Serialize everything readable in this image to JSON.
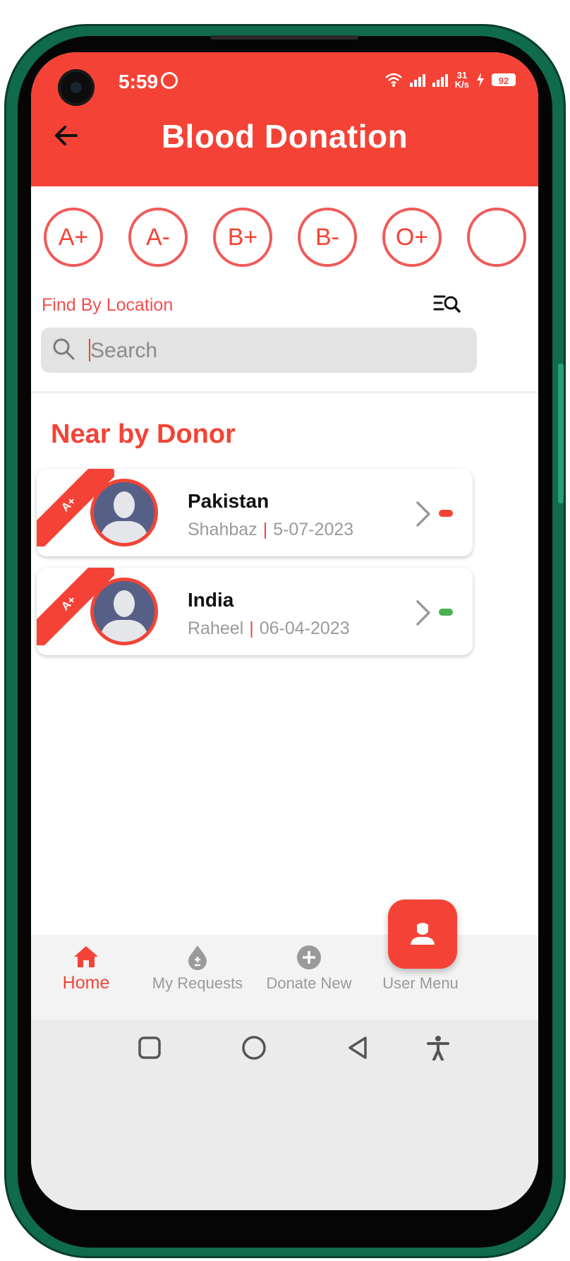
{
  "status_bar": {
    "time": "5:59",
    "net_speed_value": "31",
    "net_speed_unit": "K/s",
    "battery": "92"
  },
  "header": {
    "title": "Blood Donation"
  },
  "blood_groups": [
    "A+",
    "A-",
    "B+",
    "B-",
    "O+",
    ""
  ],
  "filters": {
    "find_by_location": "Find By Location"
  },
  "search": {
    "placeholder": "Search",
    "value": ""
  },
  "section_title": "Near by Donor",
  "donors": [
    {
      "group": "A+",
      "country": "Pakistan",
      "name": "Shahbaz",
      "separator": "|",
      "date": "5-07-2023",
      "status_color": "#f44336"
    },
    {
      "group": "A+",
      "country": "India",
      "name": "Raheel",
      "separator": "|",
      "date": "06-04-2023",
      "status_color": "#4caf50"
    }
  ],
  "bottom_nav": [
    {
      "label": "Home",
      "icon": "home-icon",
      "active": true
    },
    {
      "label": "My Requests",
      "icon": "blood-drop-icon",
      "active": false
    },
    {
      "label": "Donate New",
      "icon": "add-circle-icon",
      "active": false
    },
    {
      "label": "User Menu",
      "icon": "user-icon",
      "active": false
    }
  ],
  "colors": {
    "primary": "#f44336",
    "muted": "#9a9a9a",
    "status_active": "#4caf50"
  }
}
